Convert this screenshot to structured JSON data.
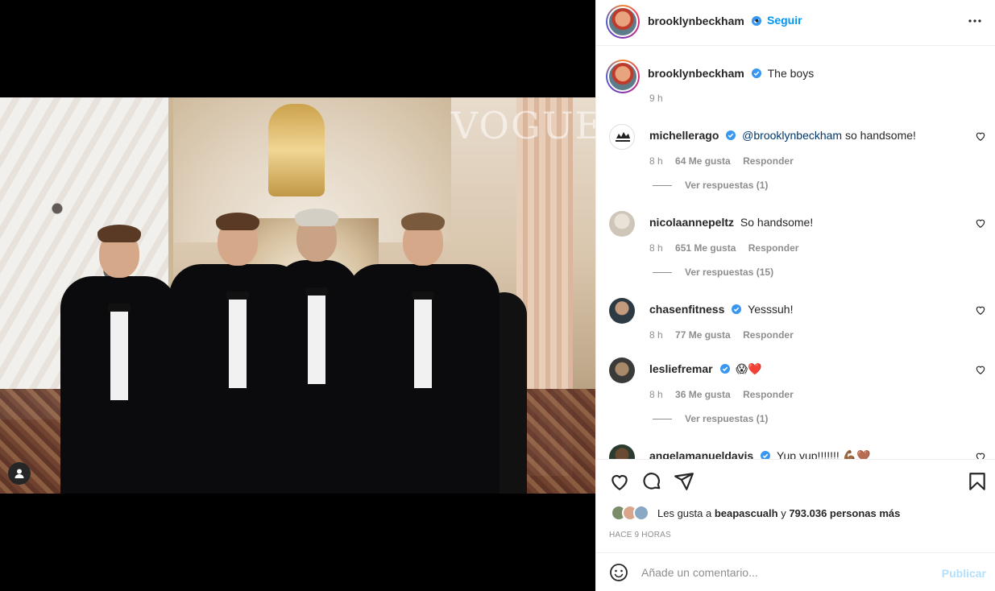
{
  "post": {
    "author": "brooklynbeckham",
    "follow_label": "Seguir",
    "dot": "•",
    "caption": "The boys",
    "caption_time": "9 h",
    "watermark": "VOGUE"
  },
  "comments": [
    {
      "user": "michellerago",
      "verified": true,
      "mention": "@brooklynbeckham",
      "text": " so handsome!",
      "time": "8 h",
      "likes": "64 Me gusta",
      "reply": "Responder",
      "replies": "Ver respuestas (1)"
    },
    {
      "user": "nicolaannepeltz",
      "verified": false,
      "mention": "",
      "text": "So handsome!",
      "time": "8 h",
      "likes": "651 Me gusta",
      "reply": "Responder",
      "replies": "Ver respuestas (15)"
    },
    {
      "user": "chasenfitness",
      "verified": true,
      "mention": "",
      "text": "Yesssuh!",
      "time": "8 h",
      "likes": "77 Me gusta",
      "reply": "Responder",
      "replies": ""
    },
    {
      "user": "lesliefremar",
      "verified": true,
      "mention": "",
      "text": "😱❤️",
      "time": "8 h",
      "likes": "36 Me gusta",
      "reply": "Responder",
      "replies": "Ver respuestas (1)"
    },
    {
      "user": "angelamanueldavis",
      "verified": true,
      "mention": "",
      "text": "Yup yup!!!!!!! 💪🏾🤎",
      "time": "",
      "likes": "",
      "reply": "",
      "replies": ""
    }
  ],
  "likes": {
    "prefix": "Les gusta a ",
    "user": "beapascualh",
    "middle": " y ",
    "count": "793.036 personas más"
  },
  "posted_ago": "HACE 9 HORAS",
  "composer": {
    "placeholder": "Añade un comentario...",
    "publish": "Publicar"
  },
  "icons": [
    "user-tag-icon",
    "verified-icon",
    "more-options-icon",
    "heart-icon",
    "comment-icon",
    "share-icon",
    "bookmark-icon",
    "emoji-icon"
  ],
  "colors": {
    "link": "#0095f6",
    "muted": "#8e8e8e",
    "verified": "#3897f0"
  }
}
